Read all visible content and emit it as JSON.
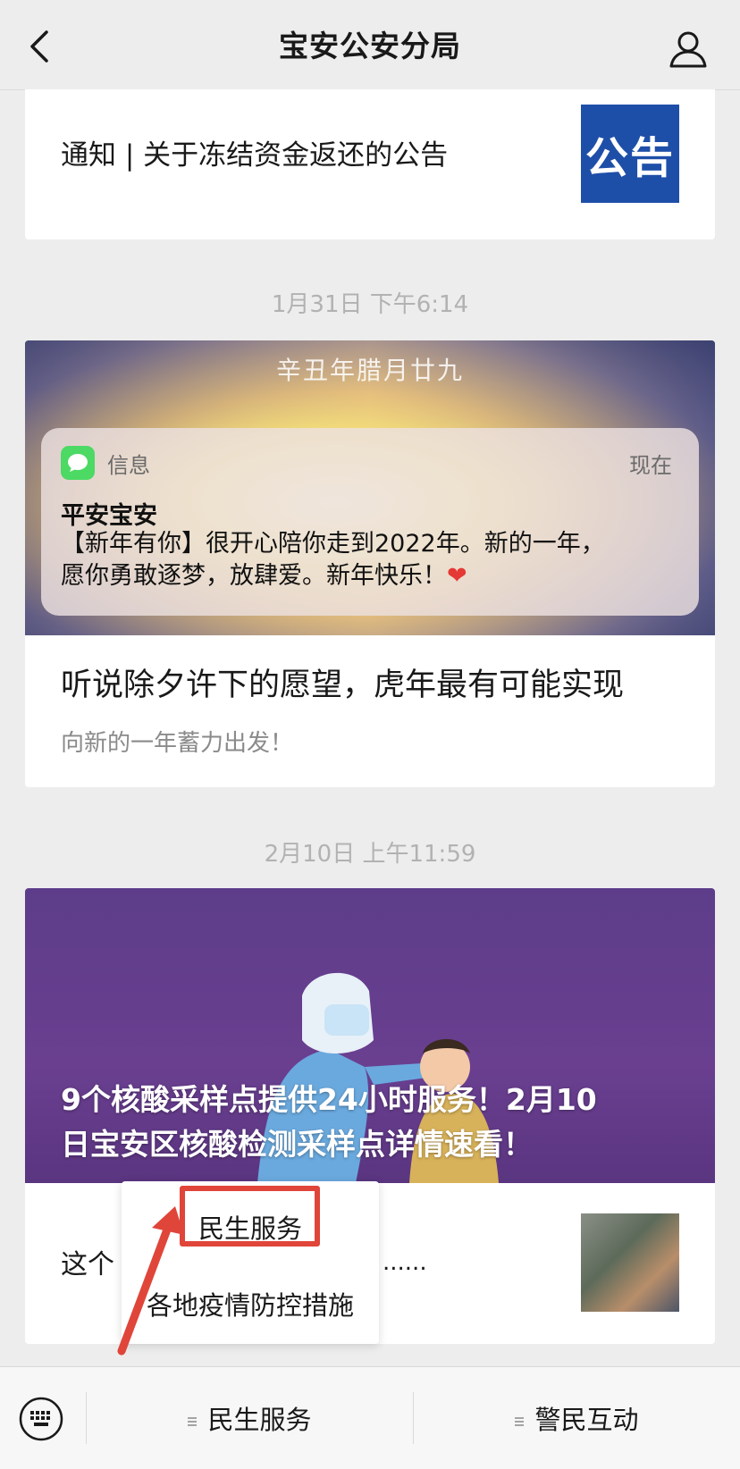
{
  "header": {
    "title": "宝安公安分局"
  },
  "notice_card": {
    "title": "通知 | 关于冻结资金返还的公告",
    "thumb_text": "公告",
    "thumb_color": "#1e4fa8"
  },
  "messages": [
    {
      "timestamp": "1月31日 下午6:14"
    },
    {
      "timestamp": "2月10日 上午11:59"
    }
  ],
  "article1": {
    "cover_caption": "辛丑年腊月廿九",
    "notification": {
      "app_name": "信息",
      "time": "现在",
      "sender": "平安宝安",
      "line1": "【新年有你】很开心陪你走到2022年。新的一年，",
      "line2": "愿你勇敢逐梦，放肆爱。新年快乐！",
      "emoji": "❤"
    },
    "title": "听说除夕许下的愿望，虎年最有可能实现",
    "subtitle": "向新的一年蓄力出发！"
  },
  "article2": {
    "title_line1": "9个核酸采样点提供24小时服务！2月10",
    "title_line2": "日宝安区核酸检测采样点详情速看！",
    "preview_start": "这个",
    "preview_ellipsis": "......"
  },
  "popup_menu": {
    "items": [
      "民生服务",
      "各地疫情防控措施"
    ]
  },
  "bottom_menu": {
    "items": [
      "民生服务",
      "警民互动"
    ]
  },
  "colors": {
    "annotation_red": "#e0453a",
    "background": "#ededed"
  }
}
